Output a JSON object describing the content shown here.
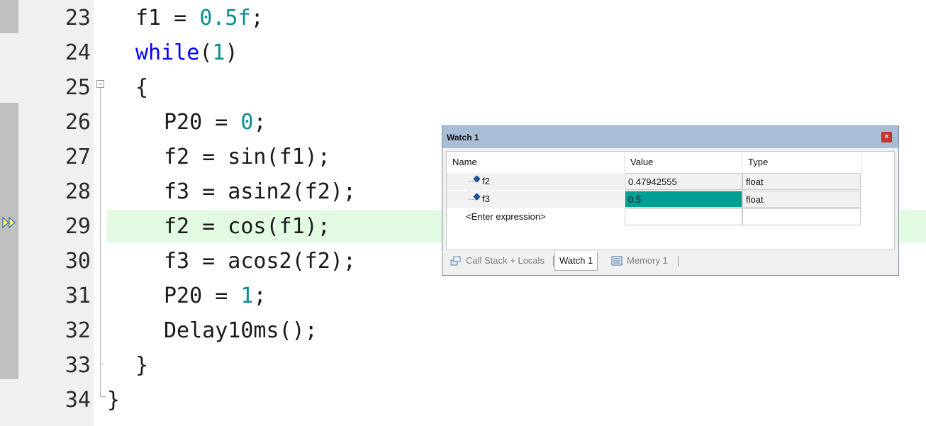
{
  "editor": {
    "current_line": "29",
    "lines": [
      {
        "num": "23",
        "indent": 1,
        "parts": [
          [
            "f1 = ",
            "t"
          ],
          [
            "0.5f",
            "n"
          ],
          [
            ";",
            "t"
          ]
        ]
      },
      {
        "num": "24",
        "indent": 1,
        "parts": [
          [
            "while",
            "k"
          ],
          [
            "(",
            "t"
          ],
          [
            "1",
            "n"
          ],
          [
            ")",
            "t"
          ]
        ]
      },
      {
        "num": "25",
        "indent": 1,
        "parts": [
          [
            "{",
            "t"
          ]
        ]
      },
      {
        "num": "26",
        "indent": 2,
        "parts": [
          [
            "P20 = ",
            "t"
          ],
          [
            "0",
            "n"
          ],
          [
            ";",
            "t"
          ]
        ]
      },
      {
        "num": "27",
        "indent": 2,
        "parts": [
          [
            "f2 = sin(f1);",
            "t"
          ]
        ]
      },
      {
        "num": "28",
        "indent": 2,
        "parts": [
          [
            "f3 = asin2(f2);",
            "t"
          ]
        ]
      },
      {
        "num": "29",
        "indent": 2,
        "parts": [
          [
            "f2 = cos(f1);",
            "t"
          ]
        ]
      },
      {
        "num": "30",
        "indent": 2,
        "parts": [
          [
            "f3 = acos2(f2);",
            "t"
          ]
        ]
      },
      {
        "num": "31",
        "indent": 2,
        "parts": [
          [
            "P20 = ",
            "t"
          ],
          [
            "1",
            "n"
          ],
          [
            ";",
            "t"
          ]
        ]
      },
      {
        "num": "32",
        "indent": 2,
        "parts": [
          [
            "Delay10ms();",
            "t"
          ]
        ]
      },
      {
        "num": "33",
        "indent": 1,
        "parts": [
          [
            "}",
            "t"
          ]
        ]
      },
      {
        "num": "34",
        "indent": 0,
        "parts": [
          [
            "}",
            "t"
          ]
        ]
      }
    ],
    "colors": {
      "keyword": "#0000ff",
      "number": "#098d8d",
      "current_line": "#e3fbe3"
    }
  },
  "watch": {
    "title": "Watch 1",
    "close_icon": "close-icon",
    "columns": {
      "name": "Name",
      "value": "Value",
      "type": "Type"
    },
    "rows": [
      {
        "name": "f2",
        "value": "0.47942555",
        "type": "float",
        "changed": false
      },
      {
        "name": "f3",
        "value": "0.5",
        "type": "float",
        "changed": true
      }
    ],
    "enter_expression": "<Enter expression>",
    "changed_color": "#009f94",
    "tabs": {
      "call_stack": "Call Stack + Locals",
      "watch": "Watch 1",
      "memory": "Memory 1"
    }
  }
}
